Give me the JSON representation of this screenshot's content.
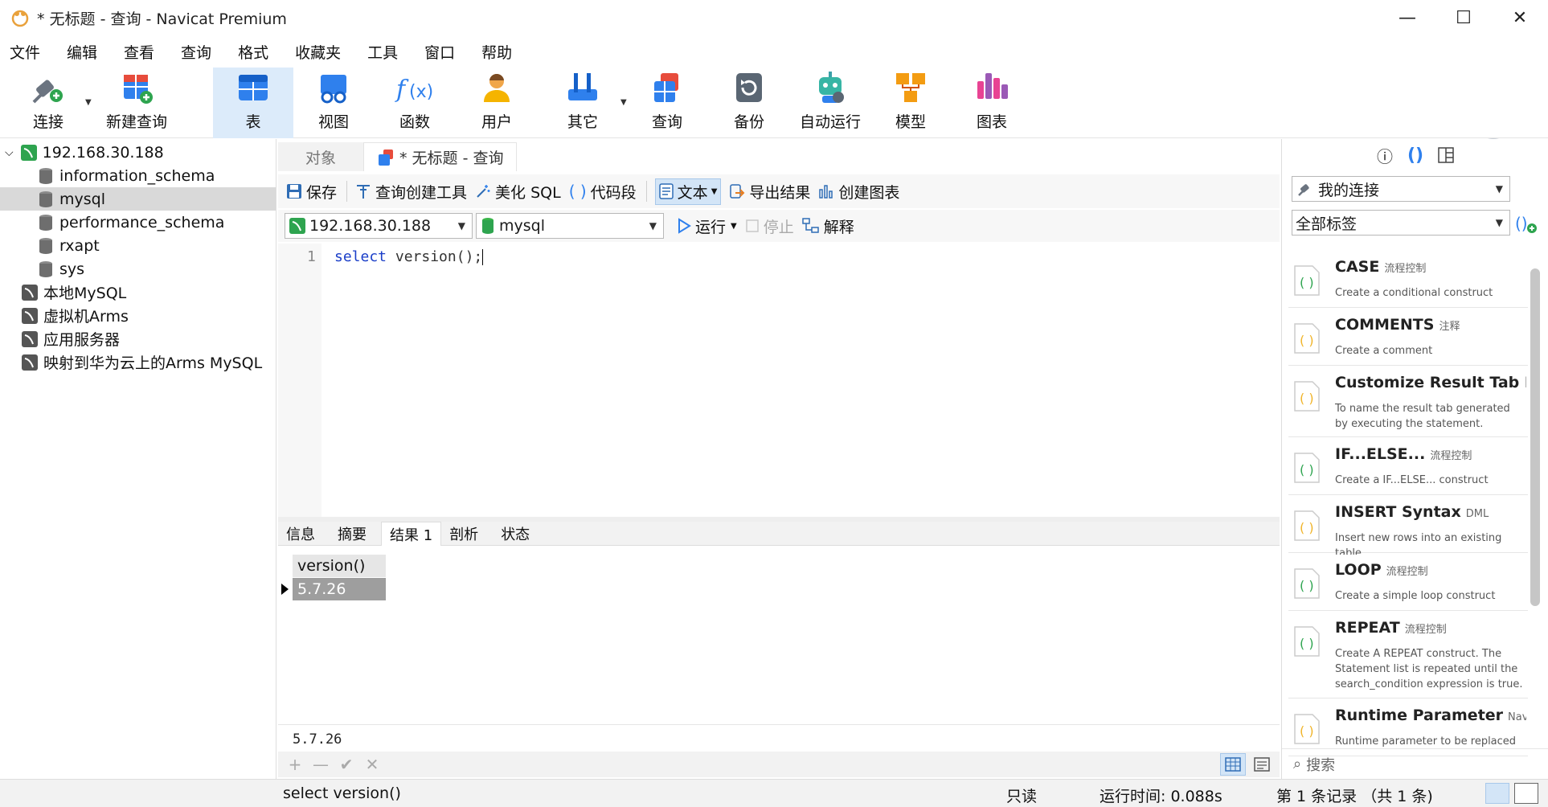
{
  "window": {
    "title": "* 无标题 - 查询 - Navicat Premium",
    "controls": {
      "minimize": "—",
      "maximize": "☐",
      "close": "✕"
    }
  },
  "menu": [
    "文件",
    "编辑",
    "查看",
    "查询",
    "格式",
    "收藏夹",
    "工具",
    "窗口",
    "帮助"
  ],
  "toolbar": {
    "connect": "连接",
    "new_query": "新建查询",
    "table": "表",
    "view": "视图",
    "function": "函数",
    "user": "用户",
    "other": "其它",
    "query": "查询",
    "backup": "备份",
    "automation": "自动运行",
    "model": "模型",
    "chart": "图表"
  },
  "tree": {
    "root": "192.168.30.188",
    "databases": [
      "information_schema",
      "mysql",
      "performance_schema",
      "rxapt",
      "sys"
    ],
    "selected": "mysql",
    "connections": [
      "本地MySQL",
      "虚拟机Arms",
      "应用服务器",
      "映射到华为云上的Arms MySQL"
    ]
  },
  "tabs": {
    "objects": "对象",
    "current": "* 无标题 - 查询"
  },
  "query_toolbar": {
    "save": "保存",
    "builder": "查询创建工具",
    "beautify": "美化 SQL",
    "snippet": "代码段",
    "text": "文本",
    "export": "导出结果",
    "create_chart": "创建图表"
  },
  "connection_bar": {
    "connection": "192.168.30.188",
    "database": "mysql",
    "run": "运行",
    "stop": "停止",
    "explain": "解释"
  },
  "editor": {
    "line_number": "1",
    "keyword": "select",
    "rest": " version();"
  },
  "result_tabs": [
    "信息",
    "摘要",
    "结果 1",
    "剖析",
    "状态"
  ],
  "result": {
    "column": "version()",
    "value": "5.7.26"
  },
  "value_pane": "5.7.26",
  "grid_actions": [
    "+",
    "—",
    "✔",
    "✕"
  ],
  "right_panel": {
    "connection_filter": "我的连接",
    "tag_filter": "全部标签",
    "search_placeholder": "搜索",
    "snippets": [
      {
        "name": "CASE",
        "tag": "流程控制",
        "desc": "Create a conditional construct"
      },
      {
        "name": "COMMENTS",
        "tag": "注释",
        "desc": "Create a comment"
      },
      {
        "name": "Customize Result Tab Nam",
        "tag": "",
        "desc": "To name the result tab generated by executing the statement."
      },
      {
        "name": "IF...ELSE...",
        "tag": "流程控制",
        "desc": "Create a IF...ELSE... construct"
      },
      {
        "name": "INSERT Syntax",
        "tag": "DML",
        "desc": "Insert new rows into an existing table"
      },
      {
        "name": "LOOP",
        "tag": "流程控制",
        "desc": "Create a simple loop construct"
      },
      {
        "name": "REPEAT",
        "tag": "流程控制",
        "desc": "Create A REPEAT construct. The Statement list is repeated until the search_condition expression is true."
      },
      {
        "name": "Runtime Parameter",
        "tag": "Navicat-",
        "desc": "Runtime parameter to be replaced"
      }
    ]
  },
  "statusbar": {
    "sql": "select version()",
    "readonly": "只读",
    "runtime": "运行时间: 0.088s",
    "records": "第 1 条记录 （共 1 条)"
  },
  "colors": {
    "accent": "#1f7ae0",
    "selected_bg": "#dcebfa",
    "green": "#2ea44f"
  }
}
